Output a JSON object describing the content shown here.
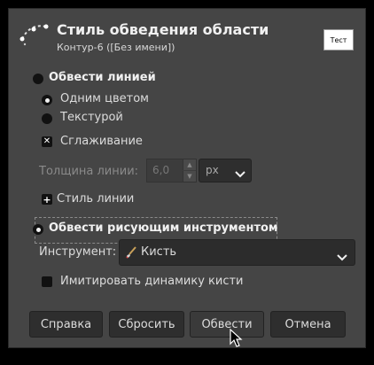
{
  "dialog": {
    "title": "Стиль обведения области",
    "subtitle": "Контур-6 ([Без имени])",
    "badge": "Тест"
  },
  "stroke_line": {
    "label": "Обвести линией",
    "solid_color": "Одним цветом",
    "pattern": "Текстурой",
    "antialiasing": "Сглаживание",
    "line_width_label": "Толщина линии:",
    "line_width_value": "6,0",
    "unit": "px",
    "line_style": "Стиль линии"
  },
  "stroke_tool": {
    "label": "Обвести рисующим инструментом",
    "tool_label": "Инструмент:",
    "tool_value": "Кисть",
    "emulate_dynamics": "Имитировать динамику кисти"
  },
  "buttons": {
    "help": "Справка",
    "reset": "Сбросить",
    "stroke": "Обвести",
    "cancel": "Отмена"
  },
  "colors": {
    "dialog_bg": "#454545",
    "button_bg": "#2e2e2e"
  }
}
